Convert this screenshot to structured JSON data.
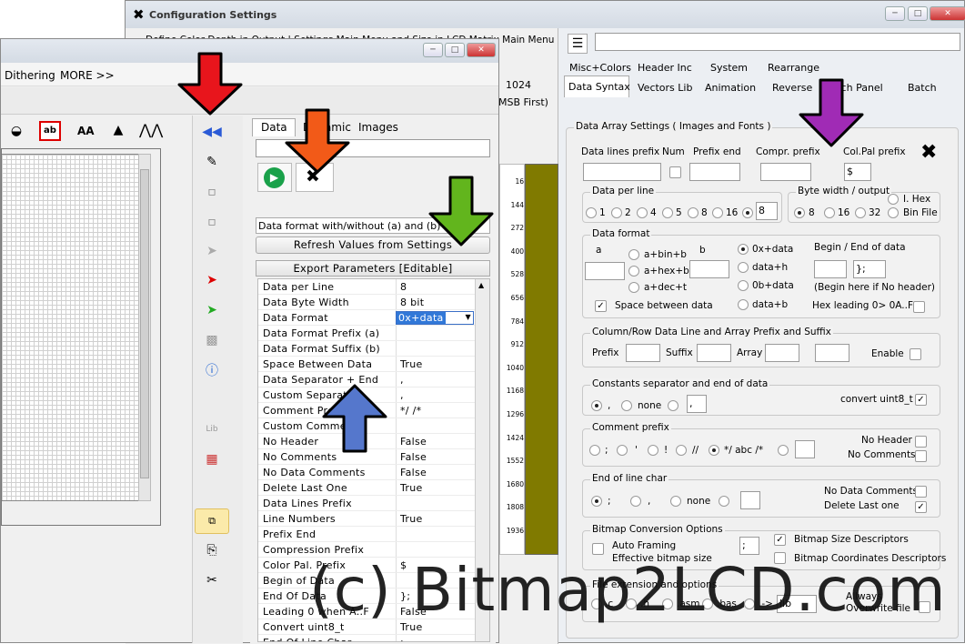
{
  "config_window": {
    "title": "Configuration Settings",
    "menu_text": "Define Color Depth in Output  |  Settings Main Menu and Size in LCD Matrix Main Menu",
    "bg_label_1024": "1024",
    "bg_label_msb": "MSB First)",
    "tabs_row1": [
      "Misc+Colors",
      "Header Inc",
      "System",
      "Rearrange"
    ],
    "tabs_row2": [
      "Data Syntax",
      "Vectors Lib",
      "Animation",
      "Reverse",
      "Touch Panel",
      "Batch"
    ],
    "data_array": {
      "title": "Data Array Settings ( Images and Fonts )",
      "data_lines_prefix": "Data lines prefix",
      "num": "Num",
      "prefix_end": "Prefix end",
      "compr_prefix": "Compr. prefix",
      "col_pal_prefix": "Col.Pal prefix",
      "col_pal_value": "$"
    },
    "data_per_line": {
      "title": "Data per line",
      "options": [
        "1",
        "2",
        "4",
        "5",
        "8",
        "16"
      ],
      "custom_value": "8"
    },
    "byte_width": {
      "title": "Byte width / output",
      "options": [
        "8",
        "16",
        "32"
      ],
      "i_hex": "I. Hex",
      "bin_file": "Bin File"
    },
    "data_format": {
      "title": "Data format",
      "a": "a",
      "b": "b",
      "opts_left": [
        "a+bin+b",
        "a+hex+b",
        "a+dec+t"
      ],
      "opts_right": [
        "0x+data",
        "data+h",
        "0b+data",
        "data+b"
      ],
      "begin_end": "Begin / End of data",
      "end_value": "};",
      "begin_hint": "(Begin here if No header)",
      "hex_leading": "Hex leading 0> 0A..F",
      "space_between": "Space between data"
    },
    "column_row": {
      "title": "Column/Row Data Line and Array Prefix and Suffix",
      "prefix": "Prefix",
      "suffix": "Suffix",
      "array": "Array",
      "enable": "Enable"
    },
    "constants": {
      "title": "Constants separator and end of data",
      "comma": ",",
      "none": "none",
      "value": ",",
      "convert": "convert uint8_t"
    },
    "comment_prefix": {
      "title": "Comment prefix",
      "opts": [
        ";",
        "'",
        "!",
        "//",
        "*/ abc /*"
      ],
      "no_header": "No Header",
      "no_comments": "No Comments"
    },
    "eol": {
      "title": "End of line char",
      "opts": [
        ";",
        ",",
        "none"
      ],
      "no_data_comments": "No Data Comments",
      "delete_last": "Delete Last one"
    },
    "bitmap_conv": {
      "title": "Bitmap Conversion Options",
      "auto_framing": "Auto Framing",
      "effective": "Effective bitmap size",
      "value": ";",
      "size_desc": "Bitmap Size Descriptors",
      "coord_desc": "Bitmap Coordinates Descriptors"
    },
    "file_ext": {
      "title": "File extension and options",
      "opts": [
        ".c",
        ".h",
        ".asm",
        ".bas",
        ".->"
      ],
      "lib": "lib",
      "always": "Allways",
      "overwrite": "Overwrite file"
    }
  },
  "main_window": {
    "menu_items": [
      "Dithering",
      "MORE >>"
    ],
    "tabs": [
      "Data",
      "Dynamic",
      "Images"
    ],
    "data_format_combo": "Data format with/without (a) and (b)",
    "refresh_btn": "Refresh Values from Settings",
    "export_header": "Export Parameters [Editable]",
    "params": [
      [
        "Data per Line",
        "8"
      ],
      [
        "Data Byte Width",
        "8 bit"
      ],
      [
        "Data Format",
        "0x+data"
      ],
      [
        "Data Format Prefix (a)",
        ""
      ],
      [
        "Data Format Suffix (b)",
        ""
      ],
      [
        "Space Between Data",
        "True"
      ],
      [
        "Data Separator + End",
        ","
      ],
      [
        "Custom Separator",
        ","
      ],
      [
        "Comment Prefix",
        "*/ /*"
      ],
      [
        "Custom Comment",
        ""
      ],
      [
        "No Header",
        "False"
      ],
      [
        "No Comments",
        "False"
      ],
      [
        "No Data Comments",
        "False"
      ],
      [
        "Delete Last One",
        "True"
      ],
      [
        "Data Lines Prefix",
        ""
      ],
      [
        "Line Numbers",
        "True"
      ],
      [
        "Prefix End",
        ""
      ],
      [
        "Compression Prefix",
        ""
      ],
      [
        "Color Pal. Prefix",
        "$"
      ],
      [
        "Begin of Data",
        ""
      ],
      [
        "End Of Data",
        "};"
      ],
      [
        "Leading 0 when A..F",
        "False"
      ],
      [
        "Convert uint8_t",
        "True"
      ],
      [
        "End Of Line Char",
        ";"
      ]
    ],
    "ruler_numbers": [
      "16",
      "144",
      "272",
      "400",
      "528",
      "656",
      "784",
      "912",
      "1040",
      "1168",
      "1296",
      "1424",
      "1552",
      "1680",
      "1808",
      "1936"
    ],
    "toolbar_labels": {
      "ab": "ab",
      "AA": "AA"
    }
  },
  "watermark": "(c) Bitmap2LCD.com",
  "colors": {
    "red_arrow": "#e8151c",
    "orange_arrow": "#f25a18",
    "green_arrow": "#62b51d",
    "purple_arrow": "#a02bb5",
    "blue_arrow": "#5577cc",
    "olive": "#807a00"
  }
}
